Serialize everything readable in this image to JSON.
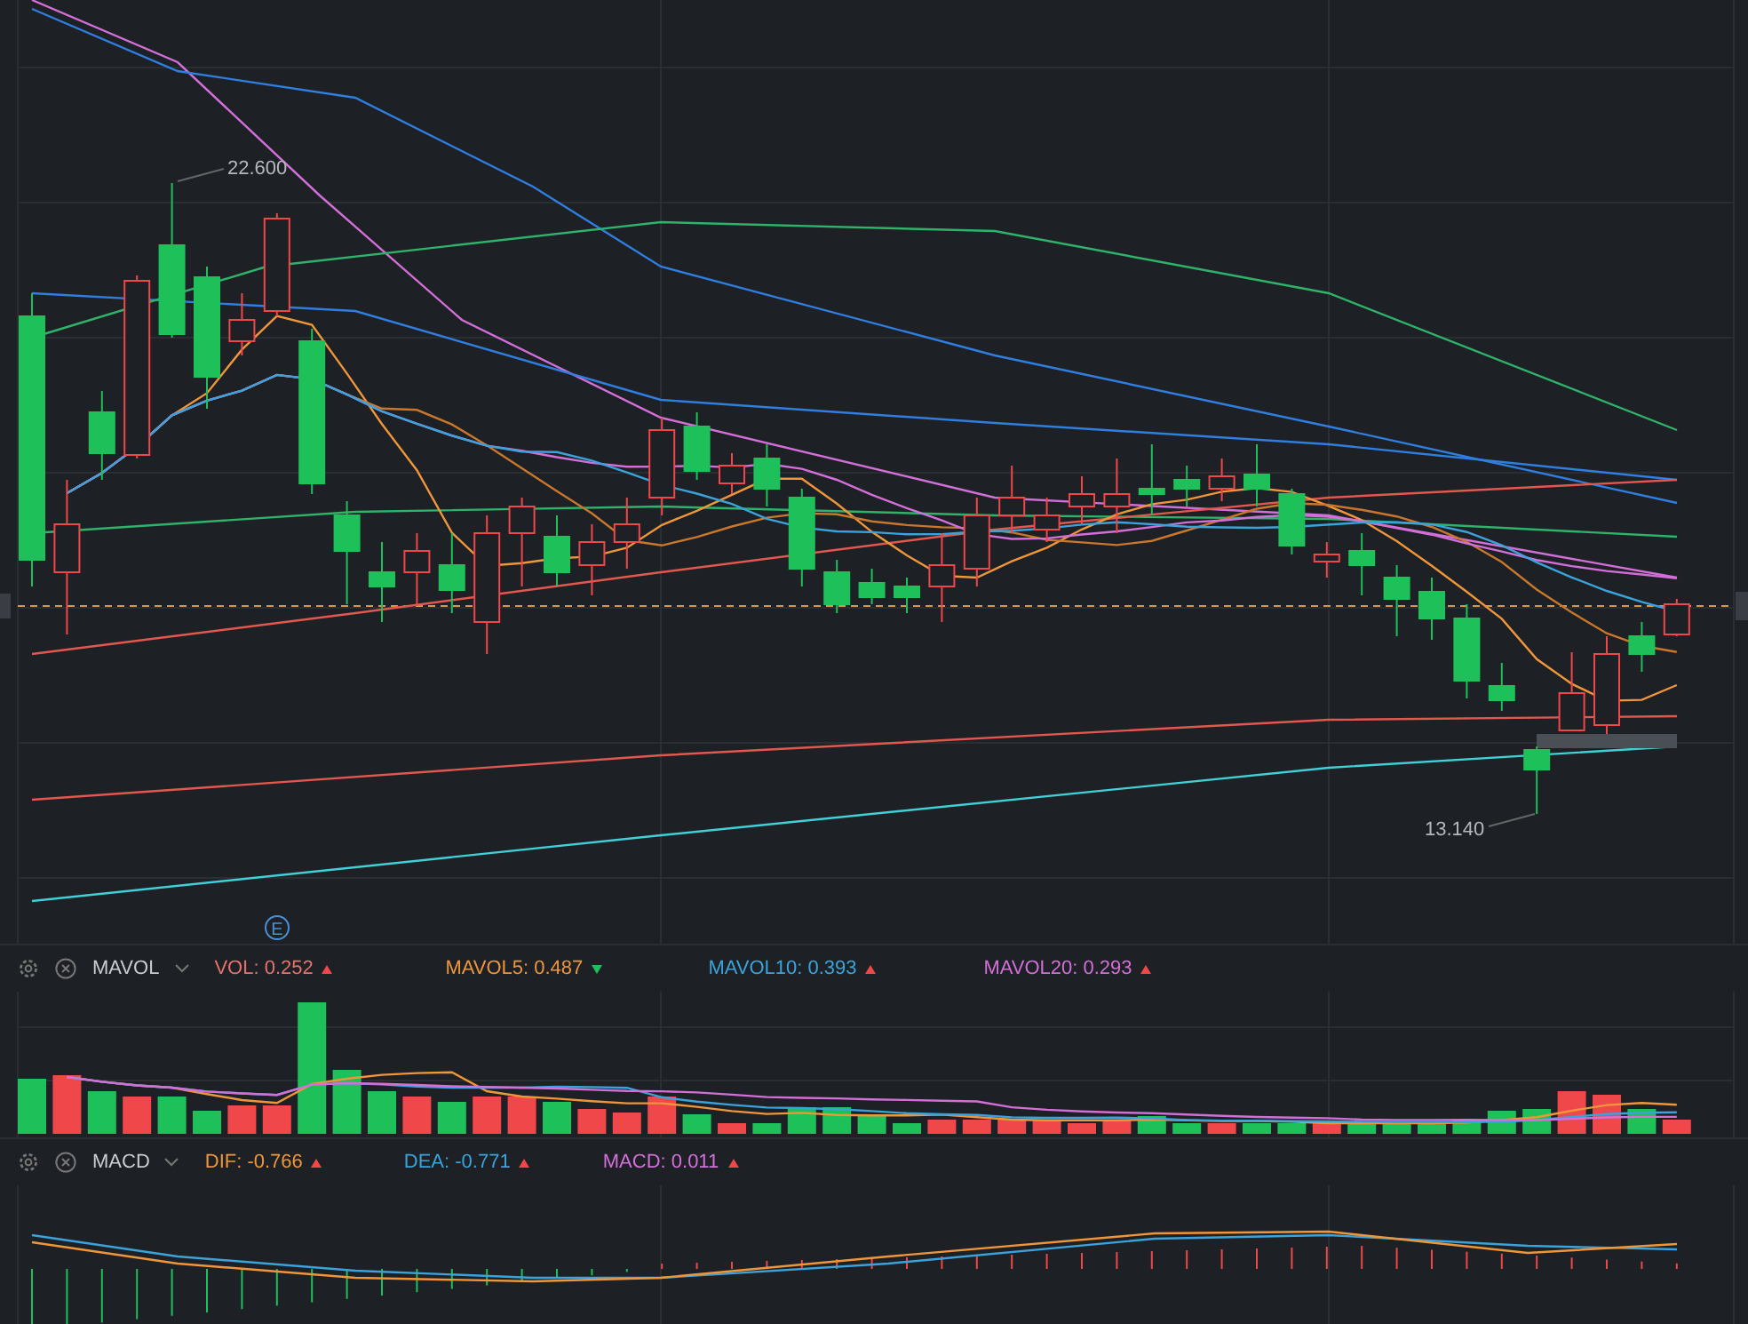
{
  "main_chart": {
    "high_label": "22.600",
    "low_label": "13.140",
    "event_marker": "E"
  },
  "volume_panel": {
    "indicator": "MAVOL",
    "readings": [
      {
        "label": "VOL: 0.252",
        "color": "#e8726d",
        "rising": true
      },
      {
        "label": "MAVOL5: 0.487",
        "color": "#f0963a",
        "rising": false
      },
      {
        "label": "MAVOL10: 0.393",
        "color": "#3ba3dc",
        "rising": true
      },
      {
        "label": "MAVOL20: 0.293",
        "color": "#d36fd8",
        "rising": true
      }
    ]
  },
  "macd_panel": {
    "indicator": "MACD",
    "readings": [
      {
        "label": "DIF: -0.766",
        "color": "#f0963a",
        "rising": true
      },
      {
        "label": "DEA: -0.771",
        "color": "#3ba3dc",
        "rising": true
      },
      {
        "label": "MACD: 0.011",
        "color": "#d36fd8",
        "rising": true
      }
    ]
  }
}
